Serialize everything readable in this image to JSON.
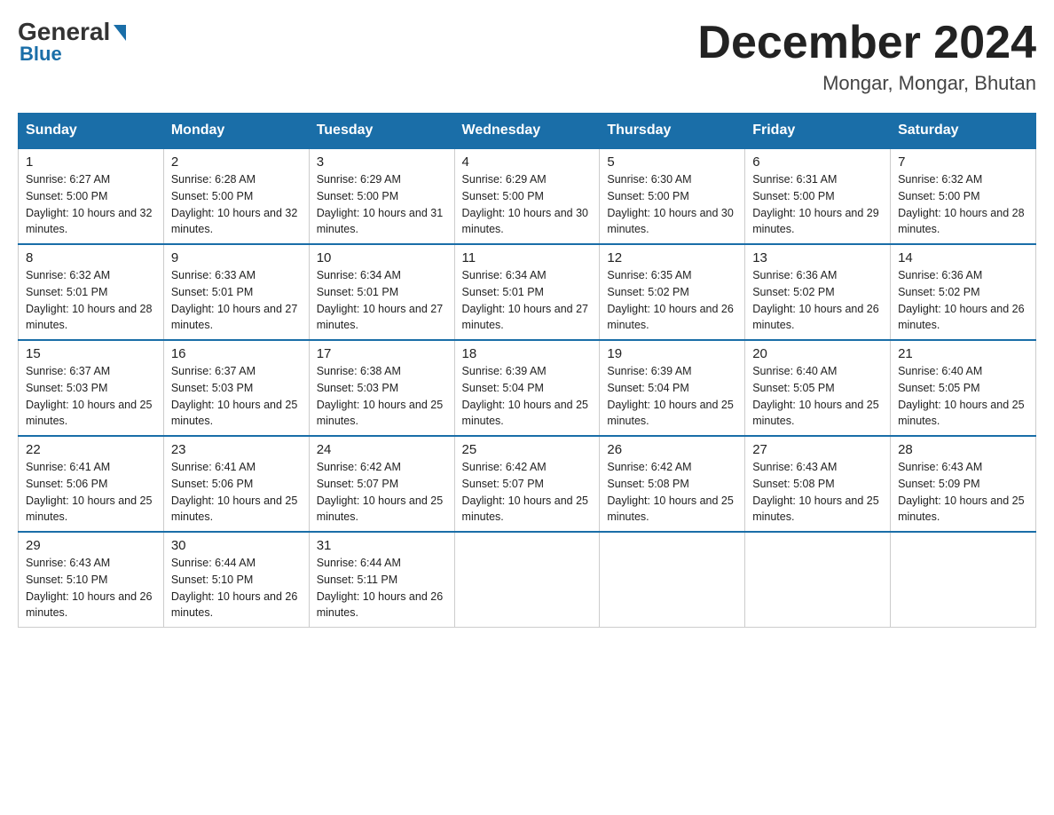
{
  "header": {
    "logo_general": "General",
    "logo_blue": "Blue",
    "month_title": "December 2024",
    "location": "Mongar, Mongar, Bhutan"
  },
  "days_of_week": [
    "Sunday",
    "Monday",
    "Tuesday",
    "Wednesday",
    "Thursday",
    "Friday",
    "Saturday"
  ],
  "weeks": [
    [
      {
        "day": "1",
        "sunrise": "6:27 AM",
        "sunset": "5:00 PM",
        "daylight": "10 hours and 32 minutes."
      },
      {
        "day": "2",
        "sunrise": "6:28 AM",
        "sunset": "5:00 PM",
        "daylight": "10 hours and 32 minutes."
      },
      {
        "day": "3",
        "sunrise": "6:29 AM",
        "sunset": "5:00 PM",
        "daylight": "10 hours and 31 minutes."
      },
      {
        "day": "4",
        "sunrise": "6:29 AM",
        "sunset": "5:00 PM",
        "daylight": "10 hours and 30 minutes."
      },
      {
        "day": "5",
        "sunrise": "6:30 AM",
        "sunset": "5:00 PM",
        "daylight": "10 hours and 30 minutes."
      },
      {
        "day": "6",
        "sunrise": "6:31 AM",
        "sunset": "5:00 PM",
        "daylight": "10 hours and 29 minutes."
      },
      {
        "day": "7",
        "sunrise": "6:32 AM",
        "sunset": "5:00 PM",
        "daylight": "10 hours and 28 minutes."
      }
    ],
    [
      {
        "day": "8",
        "sunrise": "6:32 AM",
        "sunset": "5:01 PM",
        "daylight": "10 hours and 28 minutes."
      },
      {
        "day": "9",
        "sunrise": "6:33 AM",
        "sunset": "5:01 PM",
        "daylight": "10 hours and 27 minutes."
      },
      {
        "day": "10",
        "sunrise": "6:34 AM",
        "sunset": "5:01 PM",
        "daylight": "10 hours and 27 minutes."
      },
      {
        "day": "11",
        "sunrise": "6:34 AM",
        "sunset": "5:01 PM",
        "daylight": "10 hours and 27 minutes."
      },
      {
        "day": "12",
        "sunrise": "6:35 AM",
        "sunset": "5:02 PM",
        "daylight": "10 hours and 26 minutes."
      },
      {
        "day": "13",
        "sunrise": "6:36 AM",
        "sunset": "5:02 PM",
        "daylight": "10 hours and 26 minutes."
      },
      {
        "day": "14",
        "sunrise": "6:36 AM",
        "sunset": "5:02 PM",
        "daylight": "10 hours and 26 minutes."
      }
    ],
    [
      {
        "day": "15",
        "sunrise": "6:37 AM",
        "sunset": "5:03 PM",
        "daylight": "10 hours and 25 minutes."
      },
      {
        "day": "16",
        "sunrise": "6:37 AM",
        "sunset": "5:03 PM",
        "daylight": "10 hours and 25 minutes."
      },
      {
        "day": "17",
        "sunrise": "6:38 AM",
        "sunset": "5:03 PM",
        "daylight": "10 hours and 25 minutes."
      },
      {
        "day": "18",
        "sunrise": "6:39 AM",
        "sunset": "5:04 PM",
        "daylight": "10 hours and 25 minutes."
      },
      {
        "day": "19",
        "sunrise": "6:39 AM",
        "sunset": "5:04 PM",
        "daylight": "10 hours and 25 minutes."
      },
      {
        "day": "20",
        "sunrise": "6:40 AM",
        "sunset": "5:05 PM",
        "daylight": "10 hours and 25 minutes."
      },
      {
        "day": "21",
        "sunrise": "6:40 AM",
        "sunset": "5:05 PM",
        "daylight": "10 hours and 25 minutes."
      }
    ],
    [
      {
        "day": "22",
        "sunrise": "6:41 AM",
        "sunset": "5:06 PM",
        "daylight": "10 hours and 25 minutes."
      },
      {
        "day": "23",
        "sunrise": "6:41 AM",
        "sunset": "5:06 PM",
        "daylight": "10 hours and 25 minutes."
      },
      {
        "day": "24",
        "sunrise": "6:42 AM",
        "sunset": "5:07 PM",
        "daylight": "10 hours and 25 minutes."
      },
      {
        "day": "25",
        "sunrise": "6:42 AM",
        "sunset": "5:07 PM",
        "daylight": "10 hours and 25 minutes."
      },
      {
        "day": "26",
        "sunrise": "6:42 AM",
        "sunset": "5:08 PM",
        "daylight": "10 hours and 25 minutes."
      },
      {
        "day": "27",
        "sunrise": "6:43 AM",
        "sunset": "5:08 PM",
        "daylight": "10 hours and 25 minutes."
      },
      {
        "day": "28",
        "sunrise": "6:43 AM",
        "sunset": "5:09 PM",
        "daylight": "10 hours and 25 minutes."
      }
    ],
    [
      {
        "day": "29",
        "sunrise": "6:43 AM",
        "sunset": "5:10 PM",
        "daylight": "10 hours and 26 minutes."
      },
      {
        "day": "30",
        "sunrise": "6:44 AM",
        "sunset": "5:10 PM",
        "daylight": "10 hours and 26 minutes."
      },
      {
        "day": "31",
        "sunrise": "6:44 AM",
        "sunset": "5:11 PM",
        "daylight": "10 hours and 26 minutes."
      },
      null,
      null,
      null,
      null
    ]
  ]
}
